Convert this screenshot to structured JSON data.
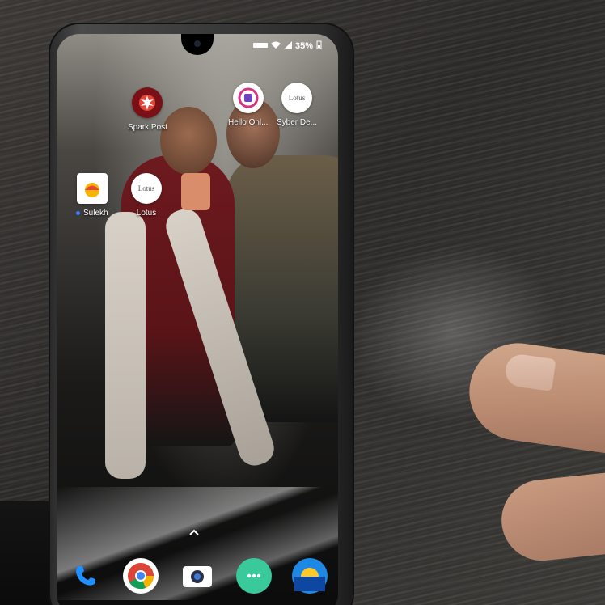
{
  "status_bar": {
    "battery": "35%",
    "wifi_icon": "wifi-icon",
    "signal_icon": "signal-icon",
    "battery_icon": "battery-icon"
  },
  "home_apps": [
    {
      "label": "Spark Post",
      "icon": "spark-post-icon"
    },
    {
      "label": "Hello Onl...",
      "icon": "hello-online-icon"
    },
    {
      "label": "Syber De...",
      "icon": "syber-icon"
    },
    {
      "label": "Sulekh",
      "icon": "sulekha-icon",
      "new_dot": true
    },
    {
      "label": "Lotus",
      "icon": "lotus-icon"
    }
  ],
  "icon_texts": {
    "lotus": "Lotus",
    "syber": "Lotus"
  },
  "dock": [
    {
      "name": "phone-app",
      "icon": "phone-icon"
    },
    {
      "name": "chrome-app",
      "icon": "chrome-icon"
    },
    {
      "name": "camera-app",
      "icon": "camera-icon"
    },
    {
      "name": "messages-app",
      "icon": "messages-icon"
    },
    {
      "name": "weather-app",
      "icon": "sun-icon"
    }
  ],
  "colors": {
    "accent_blue": "#3b7cff",
    "phone_blue": "#1e90ff",
    "messages_green": "#3ac99a"
  }
}
